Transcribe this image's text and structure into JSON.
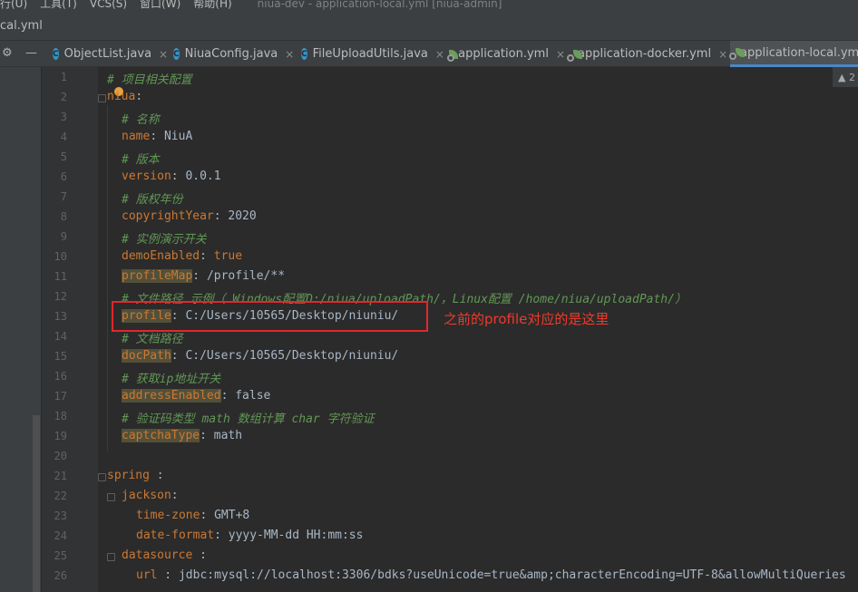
{
  "menu": {
    "items": [
      "行(U)",
      "工具(T)",
      "VCS(S)",
      "窗口(W)",
      "帮助(H)"
    ],
    "window_title": "niua-dev - application-local.yml [niua-admin]"
  },
  "breadcrumb": "cal.yml",
  "tool_icon": "⚙",
  "tool_minimize": "—",
  "tabs": [
    {
      "label": "ObjectList.java",
      "icon": "java-class-icon",
      "active": false
    },
    {
      "label": "NiuaConfig.java",
      "icon": "java-class-icon",
      "active": false
    },
    {
      "label": "FileUploadUtils.java",
      "icon": "java-class-icon",
      "active": false
    },
    {
      "label": "application.yml",
      "icon": "spring-yaml-icon",
      "active": false
    },
    {
      "label": "application-docker.yml",
      "icon": "spring-yaml-icon",
      "active": false
    },
    {
      "label": "application-local.yml",
      "icon": "spring-yaml-icon",
      "active": true
    }
  ],
  "tab_close": "×",
  "inspection": "▲ 2",
  "code_lines": [
    {
      "n": "1",
      "comment": "# 项目相关配置"
    },
    {
      "n": "2",
      "key": "niua",
      "sep": ":"
    },
    {
      "n": "3",
      "comment": "# 名称",
      "indent": 2
    },
    {
      "n": "4",
      "key": "name",
      "sep": ": ",
      "value": "NiuA",
      "indent": 2
    },
    {
      "n": "5",
      "comment": "# 版本",
      "indent": 2
    },
    {
      "n": "6",
      "key": "version",
      "sep": ": ",
      "value": "0.0.1",
      "indent": 2
    },
    {
      "n": "7",
      "comment": "# 版权年份",
      "indent": 2
    },
    {
      "n": "8",
      "key": "copyrightYear",
      "sep": ": ",
      "value": "2020",
      "indent": 2
    },
    {
      "n": "9",
      "comment": "# 实例演示开关",
      "indent": 2
    },
    {
      "n": "10",
      "key": "demoEnabled",
      "sep": ": ",
      "value": "true",
      "indent": 2,
      "value_key_color": true
    },
    {
      "n": "11",
      "key": "profileMap",
      "sep": ": ",
      "value": "/profile/**",
      "indent": 2
    },
    {
      "n": "12",
      "comment": "# 文件路径 示例（ Windows配置D:/niua/uploadPath/，Linux配置 /home/niua/uploadPath/）",
      "indent": 2
    },
    {
      "n": "13",
      "key": "profile",
      "sep": ": ",
      "value": "C:/Users/10565/Desktop/niuniu/",
      "indent": 2
    },
    {
      "n": "14",
      "comment": "# 文档路径",
      "indent": 2
    },
    {
      "n": "15",
      "key": "docPath",
      "sep": ": ",
      "value": "C:/Users/10565/Desktop/niuniu/",
      "indent": 2
    },
    {
      "n": "16",
      "comment": "# 获取ip地址开关",
      "indent": 2
    },
    {
      "n": "17",
      "key": "addressEnabled",
      "sep": ": ",
      "value": "false",
      "indent": 2
    },
    {
      "n": "18",
      "comment": "# 验证码类型 math 数组计算 char 字符验证",
      "indent": 2
    },
    {
      "n": "19",
      "key": "captchaType",
      "sep": ": ",
      "value": "math",
      "indent": 2
    },
    {
      "n": "20"
    },
    {
      "n": "21",
      "key": "spring",
      "sep": " :"
    },
    {
      "n": "22",
      "key": "jackson",
      "sep": ":",
      "indent": 2
    },
    {
      "n": "23",
      "key": "time-zone",
      "sep": ": ",
      "value": "GMT+8",
      "indent": 4
    },
    {
      "n": "24",
      "key": "date-format",
      "sep": ": ",
      "value": "yyyy-MM-dd HH:mm:ss",
      "indent": 4
    },
    {
      "n": "25",
      "key": "datasource",
      "sep": " :",
      "indent": 2
    },
    {
      "n": "26",
      "key": "url",
      "sep": " : ",
      "value": "jdbc:mysql://localhost:3306/bdks?useUnicode=true&amp;characterEncoding=UTF-8&allowMultiQueries",
      "indent": 4
    }
  ],
  "annotation": {
    "text": "之前的profile对应的是这里",
    "color": "#e1282d"
  }
}
